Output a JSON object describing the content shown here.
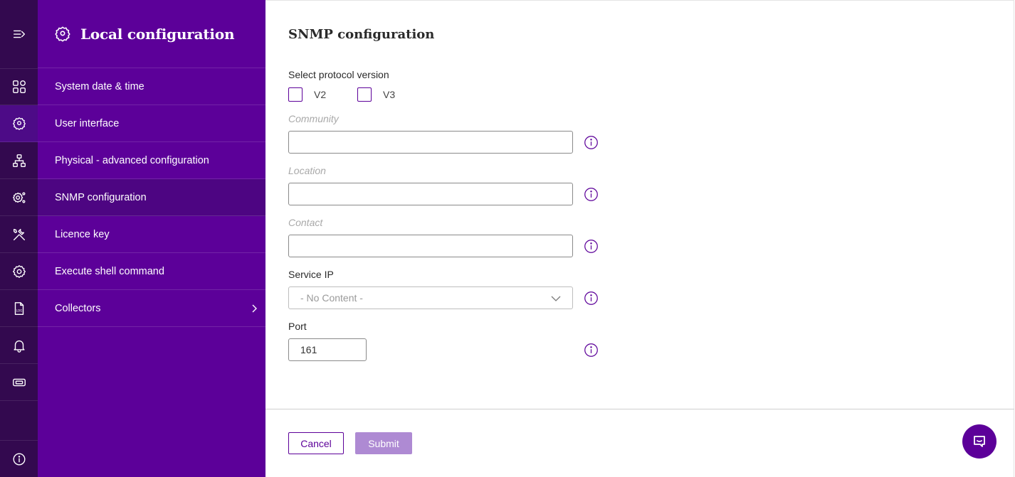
{
  "sidebar_rail": {
    "items": [
      {
        "icon": "collapse-menu-icon"
      },
      {
        "icon": "dashboard-grid-icon"
      },
      {
        "icon": "location-gear-icon"
      },
      {
        "icon": "network-topology-icon"
      },
      {
        "icon": "settings-cogs-icon"
      },
      {
        "icon": "tools-icon"
      },
      {
        "icon": "gear-icon"
      },
      {
        "icon": "log-file-icon"
      },
      {
        "icon": "bell-icon"
      },
      {
        "icon": "ticket-icon"
      },
      {
        "icon": "info-icon"
      }
    ]
  },
  "panel": {
    "title": "Local configuration",
    "items": [
      {
        "label": "System date & time"
      },
      {
        "label": "User interface"
      },
      {
        "label": "Physical - advanced configuration"
      },
      {
        "label": "SNMP configuration"
      },
      {
        "label": "Licence key"
      },
      {
        "label": "Execute shell command"
      },
      {
        "label": "Collectors"
      }
    ]
  },
  "form": {
    "title": "SNMP configuration",
    "protocol_label": "Select protocol version",
    "v2_label": "V2",
    "v3_label": "V3",
    "community_label": "Community",
    "community_value": "",
    "location_label": "Location",
    "location_value": "",
    "contact_label": "Contact",
    "contact_value": "",
    "service_ip_label": "Service IP",
    "service_ip_value": "- No Content -",
    "port_label": "Port",
    "port_value": "161",
    "cancel_label": "Cancel",
    "submit_label": "Submit"
  },
  "colors": {
    "rail_bg": "#33094f",
    "panel_bg": "#5c0099",
    "accent": "#5c0099",
    "submit_disabled": "#ae8ad3"
  }
}
